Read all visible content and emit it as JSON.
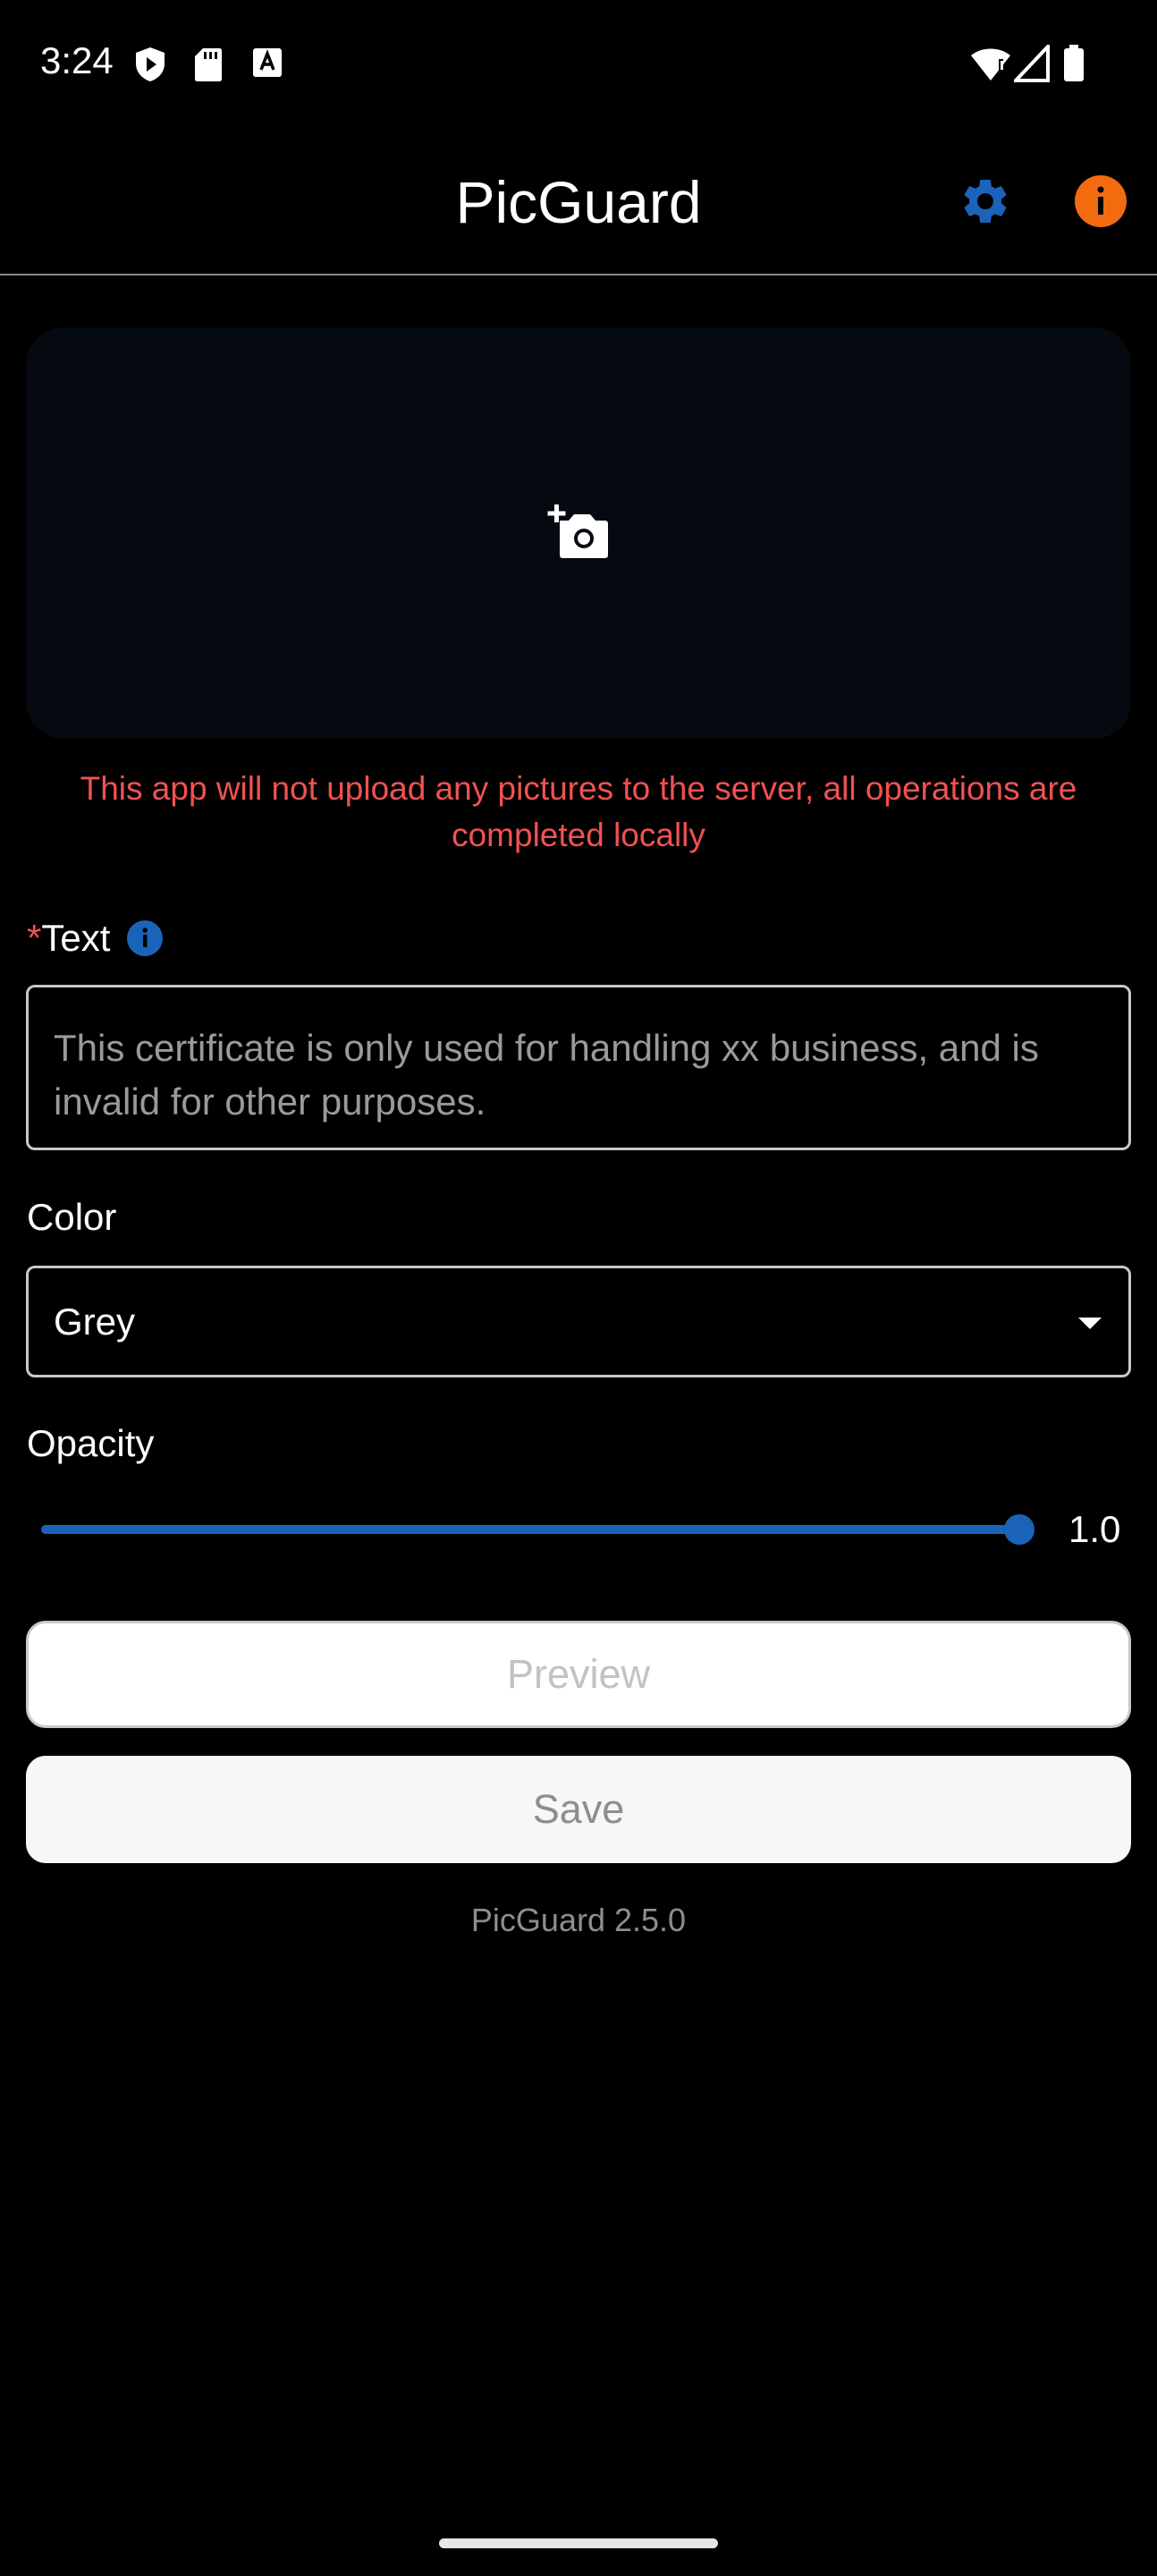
{
  "status_bar": {
    "time": "3:24",
    "left_icons": [
      "shield-play-icon",
      "sd-card-icon",
      "keyboard-a-icon"
    ],
    "right_icons": [
      "wifi-alert-icon",
      "signal-icon",
      "battery-icon"
    ]
  },
  "app_bar": {
    "title": "PicGuard",
    "settings_icon": "gear-icon",
    "info_icon": "info-icon",
    "settings_color": "#1b63b9",
    "info_color": "#f26b0f"
  },
  "image_picker": {
    "icon": "add-photo-icon"
  },
  "privacy_note": "This app will not upload any pictures to the server, all operations are completed locally",
  "text_field": {
    "required_mark": "*",
    "label": "Text",
    "info_icon": "info-icon",
    "placeholder": "This certificate is only used for handling xx business, and is invalid for other purposes."
  },
  "color_field": {
    "label": "Color",
    "value": "Grey"
  },
  "opacity": {
    "label": "Opacity",
    "value": 1.0,
    "value_text": "1.0"
  },
  "buttons": {
    "preview": "Preview",
    "save": "Save"
  },
  "footer": {
    "version": "PicGuard 2.5.0"
  },
  "colors": {
    "accent": "#1b63b9",
    "warning_text": "#f05252",
    "info_orange": "#f26b0f"
  }
}
